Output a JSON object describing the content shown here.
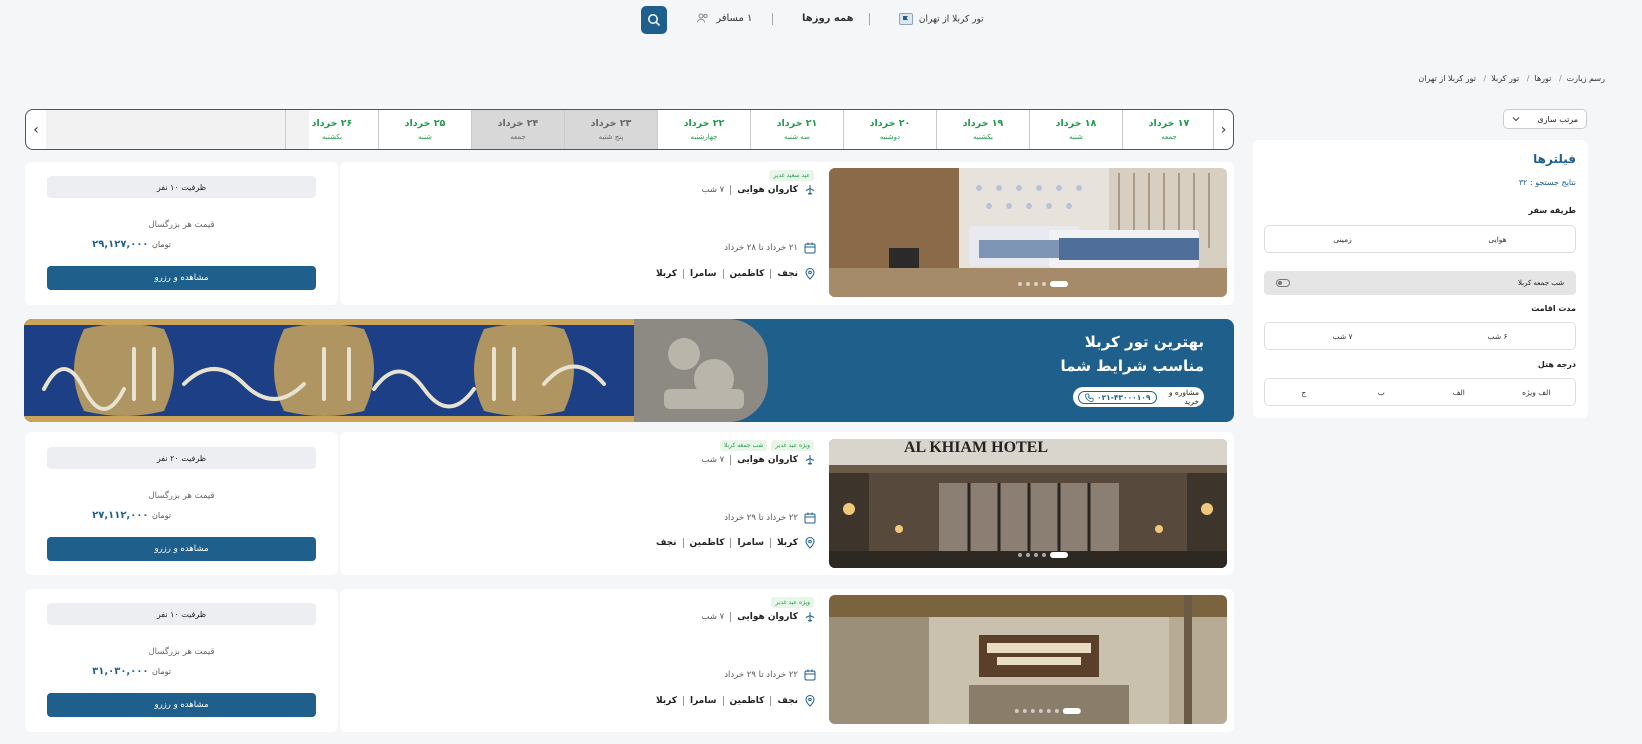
{
  "topbar": {
    "route": "تور کربلا از تهران",
    "dates": "همه روزها",
    "passengers": "۱ مسافر"
  },
  "breadcrumb": [
    "رسم زیارت",
    "تورها",
    "تور کربلا",
    "تور کربلا از تهران"
  ],
  "sort": {
    "label": "مرتب سازی"
  },
  "filters": {
    "title": "فیلترها",
    "results_label": "نتایج جستجو :",
    "results_count": "۳۲",
    "travel_method": {
      "label": "طریقه سفر",
      "options": [
        "هوایی",
        "زمینی"
      ]
    },
    "friday_night": {
      "label": "شب جمعه کربلا",
      "enabled": false
    },
    "stay": {
      "label": "مدت اقامت",
      "options": [
        "۶ شب",
        "۷ شب"
      ]
    },
    "hotel": {
      "label": "درجه هتل",
      "options": [
        "الف ویژه",
        "الف",
        "ب",
        "ج"
      ]
    }
  },
  "date_strip": [
    {
      "date": "۱۷ خرداد",
      "day": "جمعه",
      "available": true
    },
    {
      "date": "۱۸ خرداد",
      "day": "شنبه",
      "available": true
    },
    {
      "date": "۱۹ خرداد",
      "day": "یکشنبه",
      "available": true
    },
    {
      "date": "۲۰ خرداد",
      "day": "دوشنبه",
      "available": true
    },
    {
      "date": "۲۱ خرداد",
      "day": "سه شنبه",
      "available": true
    },
    {
      "date": "۲۲ خرداد",
      "day": "چهارشنبه",
      "available": true
    },
    {
      "date": "۲۳ خرداد",
      "day": "پنج شنبه",
      "available": false
    },
    {
      "date": "۲۴ خرداد",
      "day": "جمعه",
      "available": false
    },
    {
      "date": "۲۵ خرداد",
      "day": "شنبه",
      "available": true
    },
    {
      "date": "۲۶ خرداد",
      "day": "یکشنبه",
      "available": true
    }
  ],
  "tours": [
    {
      "capacity": "ظرفیت ۱۰ نفر",
      "price_label": "قیمت هر بزرگسال",
      "price": "۲۹,۱۲۷,۰۰۰",
      "currency": "تومان",
      "cta": "مشاهده و رزرو",
      "tags": [
        "عید سعید غدیر"
      ],
      "transport": "کاروان هوایی",
      "nights": "۷ شب",
      "date_range": "۲۱ خرداد  تا  ۲۸ خرداد",
      "cities": [
        "نجف",
        "کاظمین",
        "سامرا",
        "کربلا"
      ]
    },
    {
      "capacity": "ظرفیت ۲۰ نفر",
      "price_label": "قیمت هر بزرگسال",
      "price": "۲۷,۱۱۲,۰۰۰",
      "currency": "تومان",
      "cta": "مشاهده و رزرو",
      "tags": [
        "ویژه عید غدیر",
        "شب جمعه کربلا"
      ],
      "transport": "کاروان هوایی",
      "nights": "۷ شب",
      "date_range": "۲۲ خرداد  تا  ۲۹ خرداد",
      "cities": [
        "کربلا",
        "سامرا",
        "کاظمین",
        "نجف"
      ],
      "hotel_sign": "AL KHIAM HOTEL"
    },
    {
      "capacity": "ظرفیت ۱۰ نفر",
      "price_label": "قیمت هر بزرگسال",
      "price": "۳۱,۰۳۰,۰۰۰",
      "currency": "تومان",
      "cta": "مشاهده و رزرو",
      "tags": [
        "ویژه عید غدیر"
      ],
      "transport": "کاروان هوایی",
      "nights": "۷ شب",
      "date_range": "۲۲ خرداد  تا  ۲۹ خرداد",
      "cities": [
        "نجف",
        "کاظمین",
        "سامرا",
        "کربلا"
      ]
    }
  ],
  "banner": {
    "line1": "بهترین تور کربلا",
    "line2": "مناسب شرایط شما",
    "cta": "مشاوره و خرید",
    "phone": "۰۲۱-۴۳۰۰۰۱۰۹"
  },
  "colors": {
    "primary": "#1e5f8c",
    "available": "#1f9a4a",
    "unavailable": "#d8d8d8"
  }
}
